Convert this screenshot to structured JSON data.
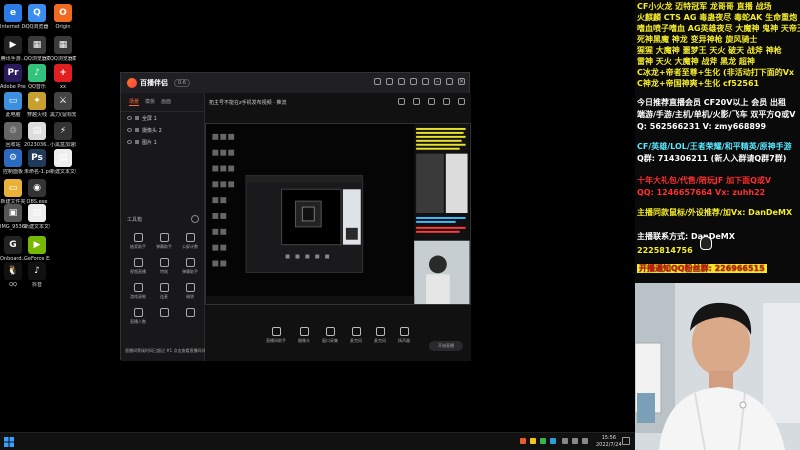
{
  "desktop": {
    "icons": [
      {
        "label": "Internet Downlo...",
        "color": "#2d7be5",
        "glyph": "e"
      },
      {
        "label": "QQ浏览器",
        "color": "#3b8df0",
        "glyph": "Q"
      },
      {
        "label": "Origin",
        "color": "#f26a21",
        "glyph": "O"
      },
      {
        "label": "腾讯手游...",
        "color": "#222222",
        "glyph": "▶"
      },
      {
        "label": "QQ浏览器截图2023...",
        "color": "#3a3a3a",
        "glyph": "▦"
      },
      {
        "label": "QQ浏览器截图2023...",
        "color": "#3a3a3a",
        "glyph": "▦"
      },
      {
        "label": "Adobe Premie...",
        "color": "#2a1a5e",
        "glyph": "Pr"
      },
      {
        "label": "QQ音乐",
        "color": "#31c27c",
        "glyph": "♪"
      },
      {
        "label": "xx",
        "color": "#e02020",
        "glyph": "+"
      },
      {
        "label": "此电脑",
        "color": "#3d8fe0",
        "glyph": "▭"
      },
      {
        "label": "穿越火线",
        "color": "#c8a030",
        "glyph": "✦"
      },
      {
        "label": "黑刀(鼠标宏)...",
        "color": "#444444",
        "glyph": "⚔"
      },
      {
        "label": "回收站",
        "color": "#666666",
        "glyph": "♲"
      },
      {
        "label": "2023036...",
        "color": "#dddddd",
        "glyph": "▤"
      },
      {
        "label": "小黑盒加速器",
        "color": "#333333",
        "glyph": "⚡"
      },
      {
        "label": "控制面板",
        "color": "#2a6bc0",
        "glyph": "⚙"
      },
      {
        "label": "未命名-1.psd",
        "color": "#1f3a5a",
        "glyph": "Ps"
      },
      {
        "label": "新建文本文档",
        "color": "#eeeeee",
        "glyph": "▤"
      },
      {
        "label": "新建文件夹",
        "color": "#e8b23a",
        "glyph": "▭"
      },
      {
        "label": "OBS.exe",
        "color": "#333333",
        "glyph": "◉"
      },
      {
        "label": "",
        "color": "#000000",
        "glyph": ""
      },
      {
        "label": "IMG_9536...",
        "color": "#555555",
        "glyph": "▣"
      },
      {
        "label": "新建文本文档(2).txt",
        "color": "#eeeeee",
        "glyph": "▤"
      },
      {
        "label": "",
        "color": "#000000",
        "glyph": ""
      },
      {
        "label": "Onboard...",
        "color": "#222222",
        "glyph": "G"
      },
      {
        "label": "GeForce Experience",
        "color": "#76b900",
        "glyph": "▶"
      },
      {
        "label": "",
        "color": "#000000",
        "glyph": ""
      },
      {
        "label": "QQ",
        "color": "#111111",
        "glyph": "🐧"
      },
      {
        "label": "抖音",
        "color": "#111111",
        "glyph": "♪"
      }
    ]
  },
  "app": {
    "name": "百播伴侣",
    "version": "0.6",
    "scene_tabs": [
      "场景",
      "模板",
      "画面"
    ],
    "scenes": [
      "全屏 1",
      "摄像头 2",
      "图片 1"
    ],
    "tools_title": "工具箱",
    "tools": [
      "抽奖助手",
      "弹幕助手",
      "公屏计数",
      "视频直播",
      "特效",
      "弹幕助手",
      "游戏录制",
      "连麦",
      "福袋",
      "直播人数",
      "",
      ""
    ],
    "footer_hint": "直播间等候时间已超过 #1 点击查看直播间详情",
    "top_info": "拓主号不能在z手机发布视频 · 推流",
    "top_tag": "推流",
    "bottom_actions": [
      "直播间助手",
      "摄像头",
      "窗口采集",
      "麦克风",
      "麦克风",
      "扬声器"
    ],
    "start_label": "开始直播"
  },
  "overlay": {
    "lines": [
      {
        "text": "CF小火龙  迈特冠军 龙哥哥  直播  战场",
        "cls": "y"
      },
      {
        "text": "火麒麟 CTS  AG  毒蛊夜尽  毒蛇AK  生命重炮",
        "cls": "y"
      },
      {
        "text": "嗜血喷子嗜血  AG英雄夜尽  大魔神 鬼神 天帝王",
        "cls": "y"
      },
      {
        "text": "死神黑魔 神龙 变异神枪  旋风骑士",
        "cls": "y"
      },
      {
        "text": "猩猩 大魔神 噩梦王  天火 破天 战斧 神枪",
        "cls": "y"
      },
      {
        "text": "雷神 天火 大魔神 战斧 黑龙 超神",
        "cls": "y"
      },
      {
        "text": "C冰龙+帝者至尊+生化  (非活动打下面的Vx",
        "cls": "y"
      },
      {
        "text": "C神龙+帝国神爽+生化        cf52561",
        "cls": "y"
      },
      {
        "text": "今日推荐直播会员  CF20V以上    会员  出租",
        "cls": "w"
      },
      {
        "text": "端游/手游/主机/单机/火影/飞车  双平方Q或V",
        "cls": "w"
      },
      {
        "text": "Q: 562566231  V: zmy668899",
        "cls": "w"
      },
      {
        "text": "CF/英雄/LOL/王者荣耀/和平精英/原神手游",
        "cls": "c"
      },
      {
        "text": "Q群: 714306211  (新人入群请Q群7群)",
        "cls": "w"
      },
      {
        "text": "十年大礼包/代售/陪玩JF  加下面Q或V",
        "cls": "r"
      },
      {
        "text": "QQ: 1246657664  Vx: zuhh22",
        "cls": "r"
      },
      {
        "text": "主播同款鼠标/外设推荐/加Vx: DanDeMX",
        "cls": "y"
      },
      {
        "text": "主播联系方式:          DanDeMX",
        "cls": "w"
      },
      {
        "text": "                        2225814756",
        "cls": "y"
      },
      {
        "text": "开播通知QQ粉丝群: 226966515",
        "cls": "warn"
      }
    ]
  },
  "taskbar": {
    "time": "15:56",
    "date": "2022/7/24"
  }
}
